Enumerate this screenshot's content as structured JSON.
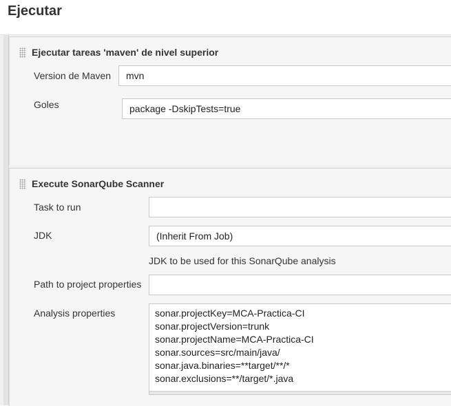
{
  "page": {
    "title": "Ejecutar"
  },
  "maven_step": {
    "title": "Ejecutar tareas 'maven' de nivel superior",
    "version_label": "Version de Maven",
    "version_value": "mvn",
    "goals_label": "Goles",
    "goals_value": "package -DskipTests=true"
  },
  "sonar_step": {
    "title": "Execute SonarQube Scanner",
    "task_label": "Task to run",
    "task_value": "",
    "jdk_label": "JDK",
    "jdk_value": "(Inherit From Job)",
    "jdk_help": "JDK to be used for this SonarQube analysis",
    "path_label": "Path to project properties",
    "path_value": "",
    "analysis_label": "Analysis properties",
    "analysis_lines": [
      "sonar.projectKey=MCA-Practica-CI",
      "sonar.projectVersion=trunk",
      "sonar.projectName=MCA-Practica-CI",
      "sonar.sources=src/main/java/",
      "sonar.java.binaries=**target/**/*",
      "sonar.exclusions=**/target/*.java"
    ]
  }
}
